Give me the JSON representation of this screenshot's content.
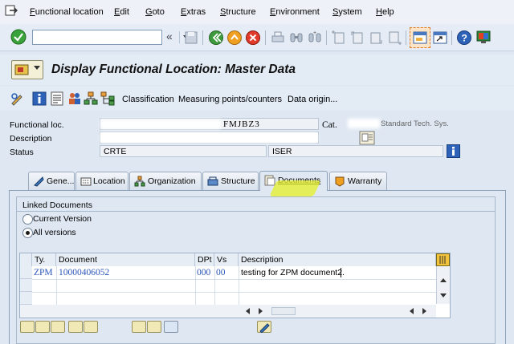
{
  "menubar": {
    "items": [
      "Functional location",
      "Edit",
      "Goto",
      "Extras",
      "Structure",
      "Environment",
      "System",
      "Help"
    ]
  },
  "toolbar": {
    "command_value": "",
    "icons": [
      "enter-icon",
      "back-nav-icon",
      "save-icon",
      "back-icon",
      "exit-icon",
      "cancel-icon",
      "print-icon",
      "find-icon",
      "find-next-icon",
      "first-page-icon",
      "previous-page-icon",
      "next-page-icon",
      "last-page-icon",
      "create-session-icon",
      "shortcut-icon",
      "help-icon",
      "customize-layout-icon"
    ]
  },
  "title": "Display Functional Location: Master Data",
  "app_toolbar": {
    "classification": "Classification",
    "measuring_points": "Measuring points/counters",
    "data_origin": "Data origin..."
  },
  "header": {
    "functional_loc_label": "Functional loc.",
    "functional_loc_value": "FMJBZ3",
    "cat_label": "Cat.",
    "cat_value": "Standard Tech. Sys.",
    "description_label": "Description",
    "status_label": "Status",
    "status_system": "CRTE",
    "status_user": "ISER"
  },
  "tabs": [
    {
      "label": "Gene..."
    },
    {
      "label": "Location"
    },
    {
      "label": "Organization"
    },
    {
      "label": "Structure"
    },
    {
      "label": "Documents",
      "active": true
    },
    {
      "label": "Warranty"
    }
  ],
  "linked_documents": {
    "group_title": "Linked Documents",
    "radio_current": "Current Version",
    "radio_all": "All versions",
    "selected": "All versions",
    "columns": [
      "Ty.",
      "Document",
      "DPt",
      "Vs",
      "Description"
    ],
    "rows": [
      {
        "type": "ZPM",
        "document": "10000406052",
        "dpt": "000",
        "version": "00",
        "description": "testing for ZPM document2."
      }
    ]
  },
  "colors": {
    "background": "#dfe7f2",
    "link_blue": "#2a56b8",
    "highlight": "#e6f028"
  }
}
